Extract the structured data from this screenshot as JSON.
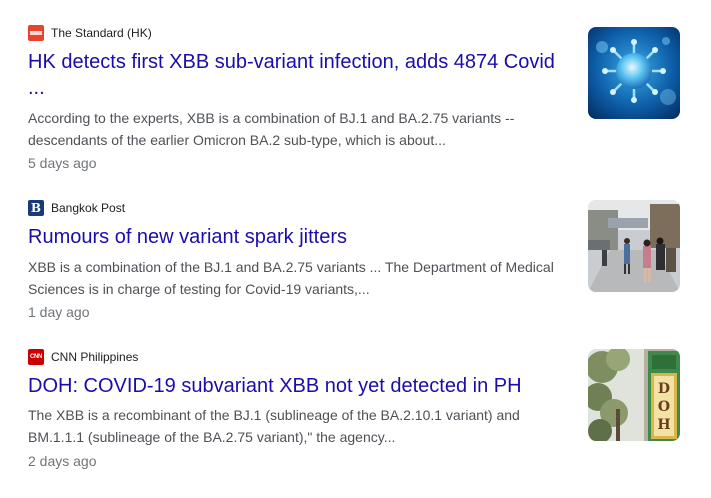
{
  "results": [
    {
      "source": "The Standard (HK)",
      "favicon": "the-standard-favicon",
      "headline_line1": "HK detects first XBB sub-variant infection, adds 4874 Covid",
      "headline_line2": "...",
      "snippet_line1": "According to the experts, XBB is a combination of BJ.1 and BA.2.75 variants --",
      "snippet_line2": "descendants of the earlier Omicron BA.2 sub-type, which is about...",
      "age": "5 days ago",
      "thumbnail": "virus-image"
    },
    {
      "source": "Bangkok Post",
      "favicon_glyph": "B",
      "headline_line1": "Rumours of new variant spark jitters",
      "snippet_line1": "XBB is a combination of the BJ.1 and BA.2.75 variants ... The Department of Medical",
      "snippet_line2": "Sciences is in charge of testing for Covid-19 variants,...",
      "age": "1 day ago",
      "thumbnail": "street-crowd-image"
    },
    {
      "source": "CNN Philippines",
      "favicon_glyph": "CNN",
      "headline_line1": "DOH: COVID-19 subvariant XBB not yet detected in PH",
      "snippet_line1": "The XBB is a recombinant of the BJ.1 (sublineage of the BA.2.10.1 variant) and",
      "snippet_line2": "BM.1.1.1 (sublineage of the BA.2.75 variant),\" the agency...",
      "age": "2 days ago",
      "thumbnail": "doh-sign-image",
      "thumbnail_sign_text": "DOH"
    }
  ],
  "colors": {
    "headline": "#1a0dab",
    "snippet": "#4d5156",
    "meta": "#70757a",
    "source": "#202124"
  }
}
